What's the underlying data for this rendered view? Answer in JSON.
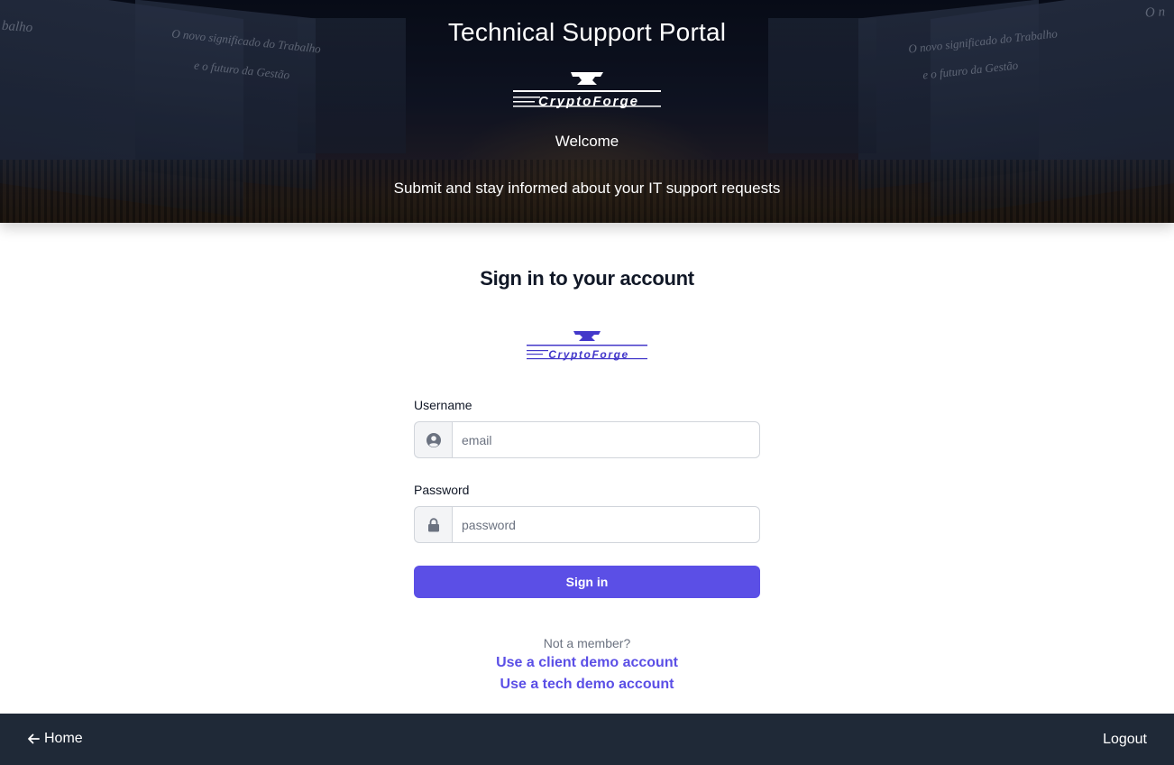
{
  "hero": {
    "title": "Technical Support Portal",
    "logo_text": "CryptoForge",
    "welcome": "Welcome",
    "subtitle": "Submit and stay informed about your IT support requests",
    "background_text": {
      "left_partial": "balho",
      "left_line1": "O novo significado do Trabalho",
      "left_line2": "e o futuro da Gestão",
      "right_line1": "O novo significado do Trabalho",
      "right_line2": "e o futuro da Gestão",
      "right_partial": "O n"
    }
  },
  "signin": {
    "title": "Sign in to your account",
    "logo_text": "CryptoForge",
    "username": {
      "label": "Username",
      "placeholder": "email",
      "value": "",
      "icon": "user-circle-icon"
    },
    "password": {
      "label": "Password",
      "placeholder": "password",
      "value": "",
      "icon": "lock-icon"
    },
    "submit_label": "Sign in",
    "not_member": "Not a member?",
    "client_demo": "Use a client demo account",
    "tech_demo": "Use a tech demo account"
  },
  "footer": {
    "home_label": "Home",
    "home_icon": "arrow-left-icon",
    "logout_label": "Logout"
  },
  "colors": {
    "accent": "#5b4fe6",
    "footer_bg": "#1f2937",
    "heading": "#111827",
    "muted": "#6b7280"
  }
}
